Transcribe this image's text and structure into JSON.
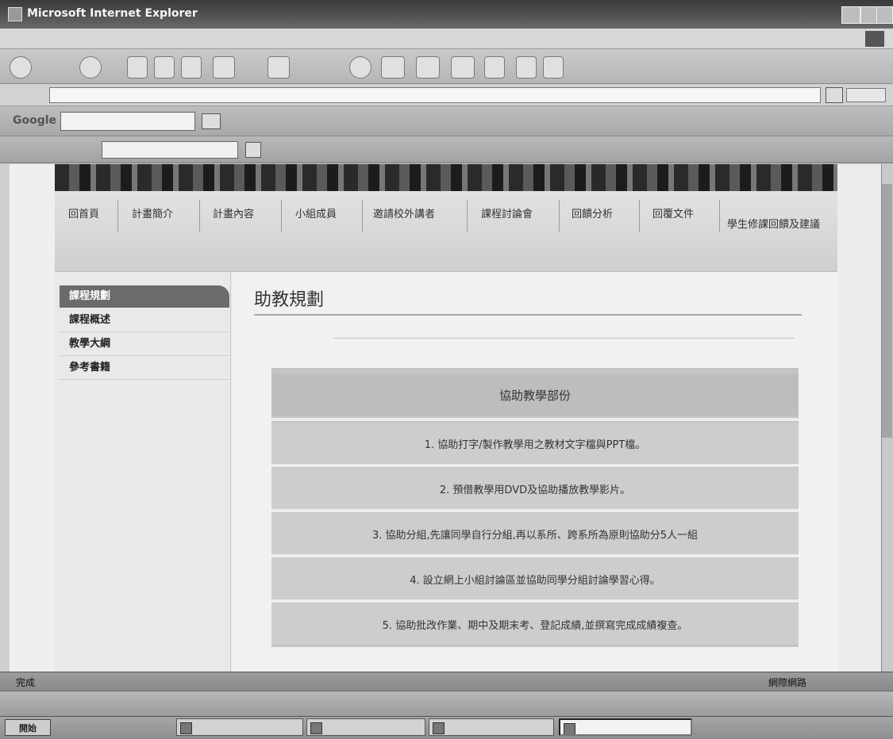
{
  "window": {
    "title": "Microsoft Internet Explorer"
  },
  "menubar": {
    "items": []
  },
  "address_bar": {
    "url": ""
  },
  "google_toolbar": {
    "brand": "Google"
  },
  "site": {
    "nav": [
      "回首頁",
      "計畫簡介",
      "計畫內容",
      "小組成員",
      "邀請校外講者",
      "課程討論會",
      "回饋分析",
      "回覆文件",
      "學生修課回饋及建議"
    ],
    "sidebar": {
      "header": "課程規劃",
      "items": [
        "課程概述",
        "教學大綱",
        "參考書籍"
      ]
    },
    "page_title": "助教規劃",
    "assist": {
      "heading": "協助教學部份",
      "rows": [
        "1. 協助打字/製作教學用之教材文字檔與PPT檔。",
        "2. 預借教學用DVD及協助播放教學影片。",
        "3. 協助分組,先讓同學自行分組,再以系所、跨系所為原則協助分5人一組",
        "4. 設立網上小組討論區並協助同學分組討論學習心得。",
        "5. 協助批改作業、期中及期末考、登記成績,並撰寫完成成績複查。"
      ]
    }
  },
  "status": {
    "text": "完成",
    "zone": "網際網路"
  },
  "langbar": {
    "label": ""
  },
  "taskbar": {
    "start": "開始",
    "windows": [],
    "clock": ""
  }
}
